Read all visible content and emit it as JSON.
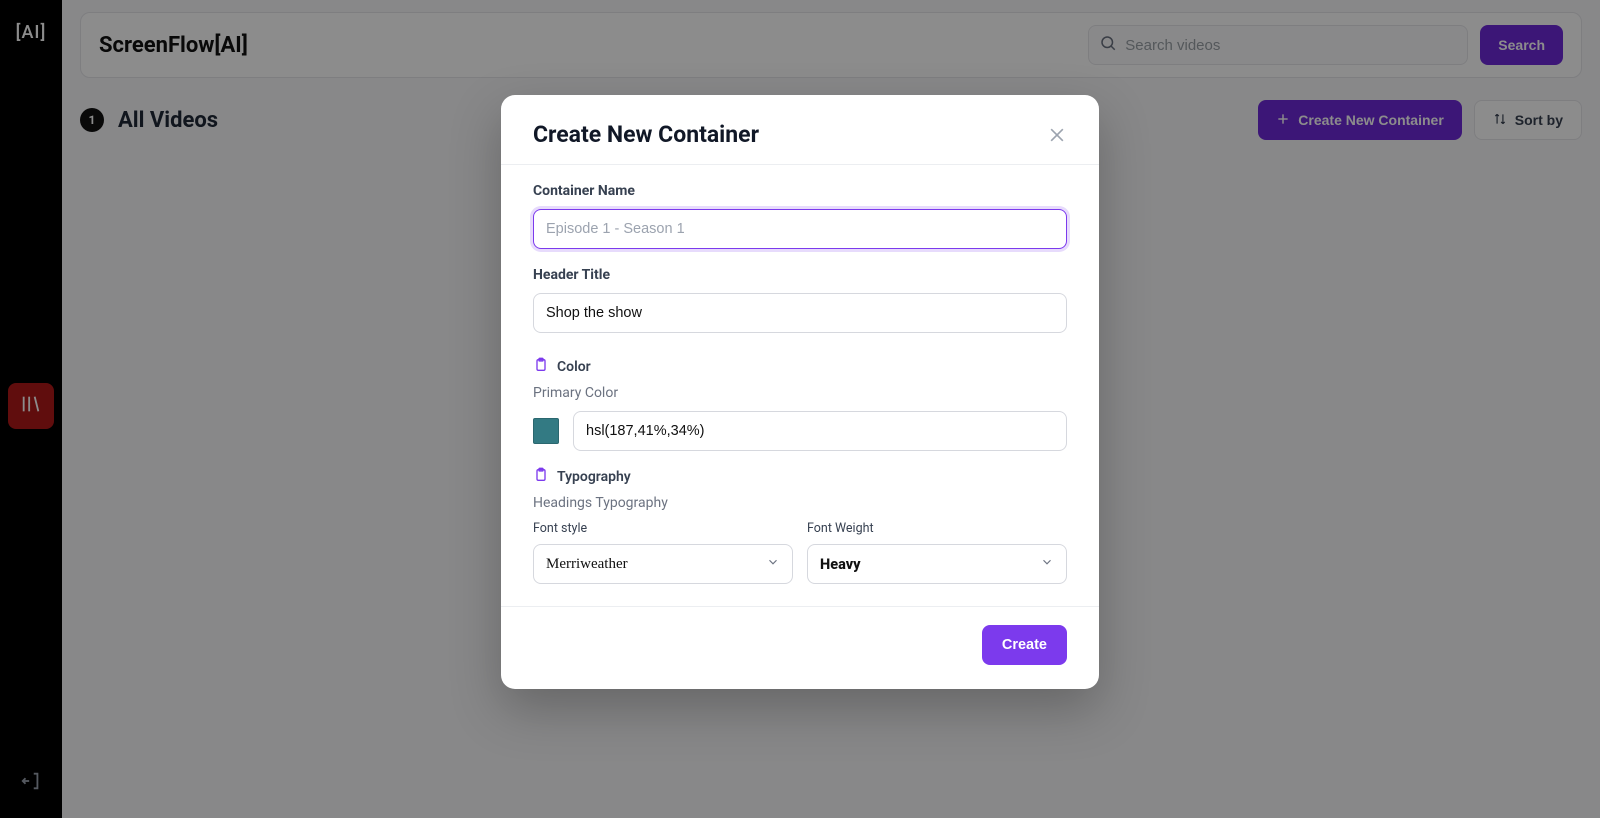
{
  "rail": {
    "logo_text": "[AI]"
  },
  "topbar": {
    "brand": "ScreenFlow[AI]",
    "search_placeholder": "Search videos",
    "search_button": "Search"
  },
  "subbar": {
    "count": "1",
    "title": "All Videos",
    "create_btn": "Create New Container",
    "sort_btn": "Sort by"
  },
  "modal": {
    "title": "Create New Container",
    "container_name_label": "Container Name",
    "container_name_placeholder": "Episode 1 - Season 1",
    "container_name_value": "",
    "header_title_label": "Header Title",
    "header_title_value": "Shop the show",
    "color_section": "Color",
    "primary_color_label": "Primary Color",
    "primary_color_value": "hsl(187,41%,34%)",
    "primary_color_swatch": "#337a83",
    "typography_section": "Typography",
    "headings_typography_label": "Headings Typography",
    "font_style_label": "Font style",
    "font_style_value": "Merriweather",
    "font_weight_label": "Font Weight",
    "font_weight_value": "Heavy",
    "create_btn": "Create"
  }
}
